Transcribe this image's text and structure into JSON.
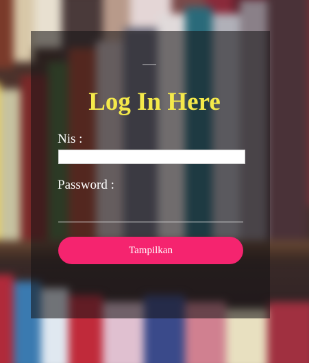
{
  "login": {
    "title": "Log In Here",
    "nis_label": "Nis :",
    "nis_value": "",
    "password_label": "Password :",
    "password_value": "",
    "submit_label": "Tampilkan"
  },
  "colors": {
    "title": "#f4e94a",
    "button": "#f5246f",
    "card_overlay": "rgba(20,18,20,0.55)"
  }
}
